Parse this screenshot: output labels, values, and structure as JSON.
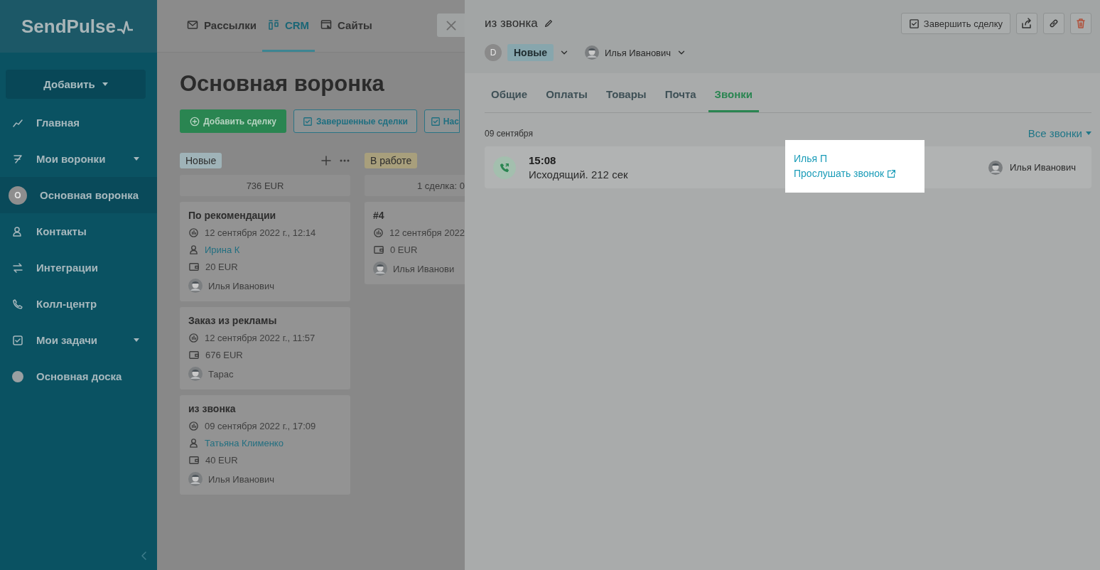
{
  "sidebar": {
    "logo": "SendPulse",
    "add_button": "Добавить",
    "items": [
      {
        "label": "Главная",
        "caret": false,
        "selected": false
      },
      {
        "label": "Мои воронки",
        "caret": true,
        "selected": false
      },
      {
        "label": "Основная воронка",
        "avatar_letter": "O",
        "caret": false,
        "selected": true
      },
      {
        "label": "Контакты",
        "caret": false,
        "selected": false
      },
      {
        "label": "Интеграции",
        "caret": false,
        "selected": false
      },
      {
        "label": "Колл-центр",
        "caret": false,
        "selected": false
      },
      {
        "label": "Мои задачи",
        "caret": true,
        "selected": false
      },
      {
        "label": "Основная доска",
        "caret": false,
        "selected": false
      }
    ]
  },
  "top_nav": [
    {
      "label": "Рассылки",
      "selected": false
    },
    {
      "label": "CRM",
      "selected": true
    },
    {
      "label": "Сайты",
      "selected": false
    }
  ],
  "board": {
    "title": "Основная воронка",
    "buttons": [
      {
        "label": "Добавить сделку",
        "kind": "primary"
      },
      {
        "label": "Завершенные сделки",
        "kind": "outline"
      },
      {
        "label": "Нас",
        "kind": "outline"
      }
    ],
    "columns": [
      {
        "name": "Новые",
        "color": "#9fb3b8",
        "summary": "736 EUR",
        "actions": true,
        "cards": [
          {
            "title": "По рекомендации",
            "date": "12 сентября 2022 г., 12:14",
            "contact": "Ирина К",
            "amount": "20 EUR",
            "owner": "Илья Иванович"
          },
          {
            "title": "Заказ из рекламы",
            "date": "12 сентября 2022 г., 11:57",
            "amount": "676 EUR",
            "owner": "Тарас"
          },
          {
            "title": "из звонка",
            "date": "09 сентября 2022 г., 17:09",
            "contact": "Татьяна Клименко",
            "amount": "40 EUR",
            "owner": "Илья Иванович"
          }
        ]
      },
      {
        "name": "В работе",
        "color": "#a89f7c",
        "summary": "1 сделка: 0",
        "actions": false,
        "cards": [
          {
            "title": "#4",
            "date": "12 сентября 2022",
            "amount": "0 EUR",
            "owner": "Илья Иванови"
          }
        ]
      }
    ]
  },
  "panel": {
    "title": "из звонка",
    "complete_button": "Завершить сделку",
    "stage_avatar": "D",
    "stage": "Новые",
    "owner": "Илья Иванович",
    "tabs": [
      {
        "label": "Общие",
        "selected": false
      },
      {
        "label": "Оплаты",
        "selected": false
      },
      {
        "label": "Товары",
        "selected": false
      },
      {
        "label": "Почта",
        "selected": false
      },
      {
        "label": "Звонки",
        "selected": true
      }
    ],
    "date_label": "09 сентября",
    "all_calls": "Все звонки",
    "calls": [
      {
        "time": "15:08",
        "description": "Исходящий. 212 сек",
        "contact": "Илья П",
        "listen_link": "Прослушать звонок",
        "owner": "Илья Иванович"
      }
    ]
  }
}
